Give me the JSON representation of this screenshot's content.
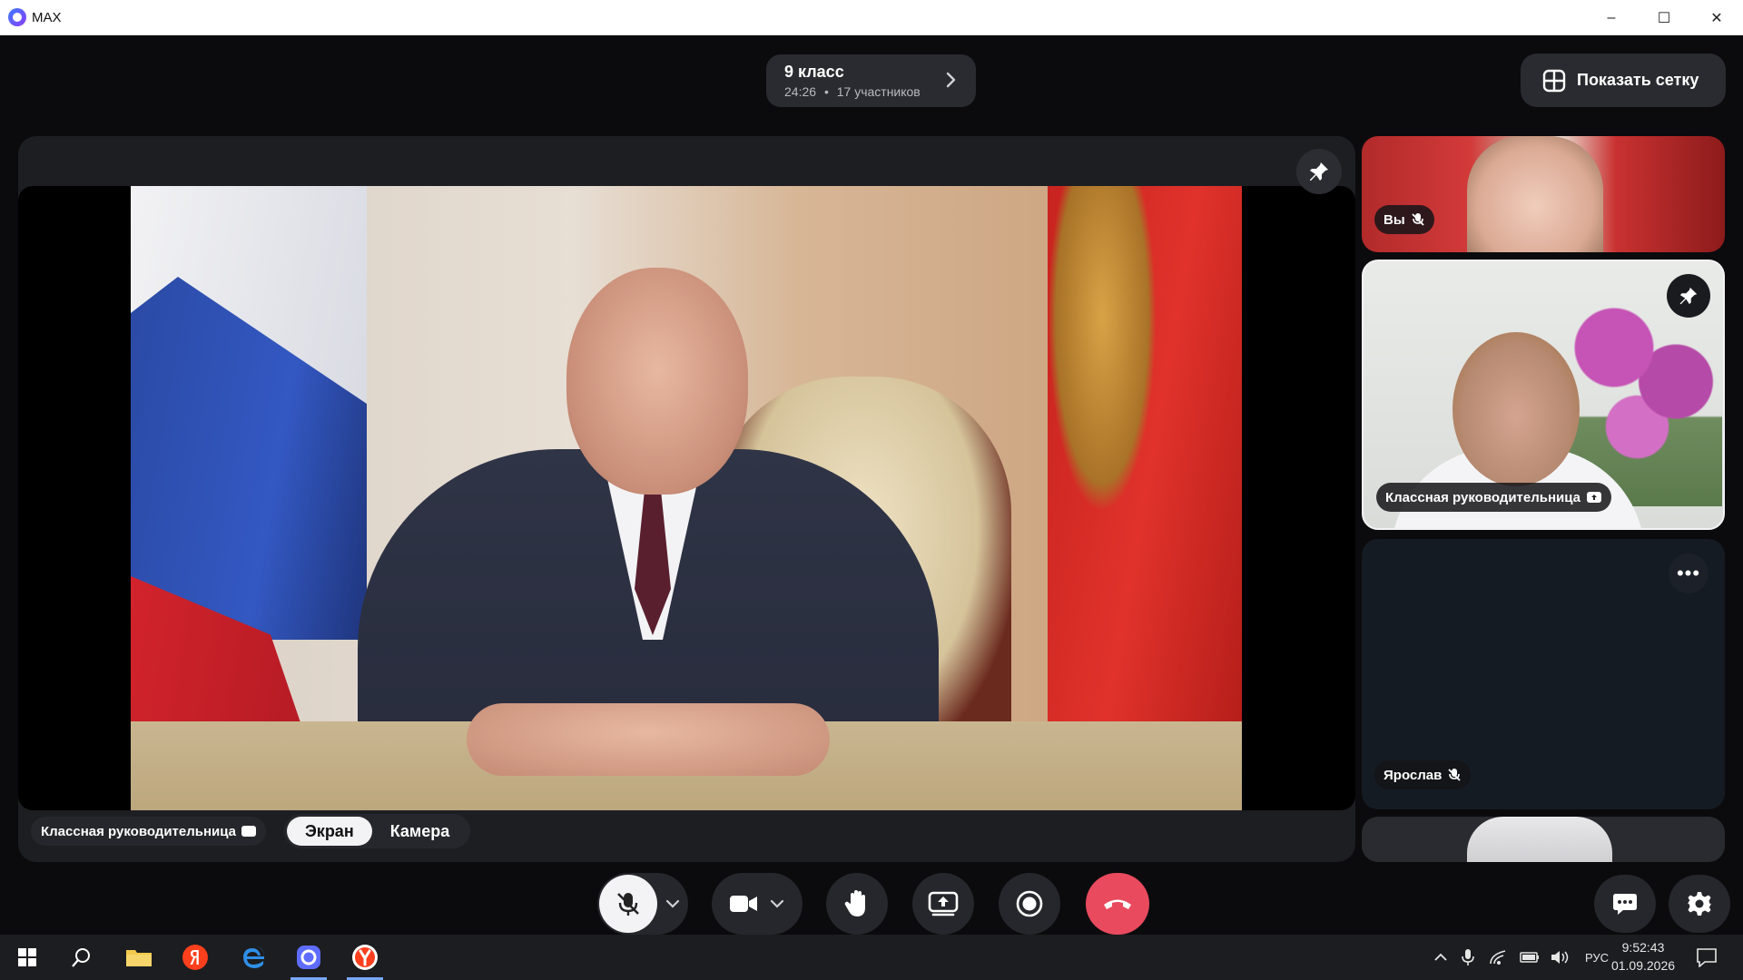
{
  "window": {
    "app_title": "MAX",
    "minimize": "–",
    "maximize": "☐",
    "close": "✕"
  },
  "call": {
    "name": "9 класс",
    "duration": "24:26",
    "separator": "•",
    "participants": "17 участников"
  },
  "toolbar": {
    "grid_button_label": "Показать сетку"
  },
  "stage": {
    "speaker_label": "Классная руководительница",
    "view_tabs": [
      "Экран",
      "Камера"
    ],
    "active_tab": "Экран"
  },
  "tiles": [
    {
      "label": "Вы",
      "muted": true
    },
    {
      "label": "Классная руководительница",
      "sharing": true,
      "pinned": true
    },
    {
      "label": "Ярослав",
      "muted": true,
      "more": "•••"
    }
  ],
  "taskbar": {
    "language": "РУС",
    "time": "9:52:43",
    "date": "01.09.2026"
  },
  "colors": {
    "end_call": "#e94a5e",
    "panel": "#26272c",
    "background": "#0b0b0e"
  }
}
